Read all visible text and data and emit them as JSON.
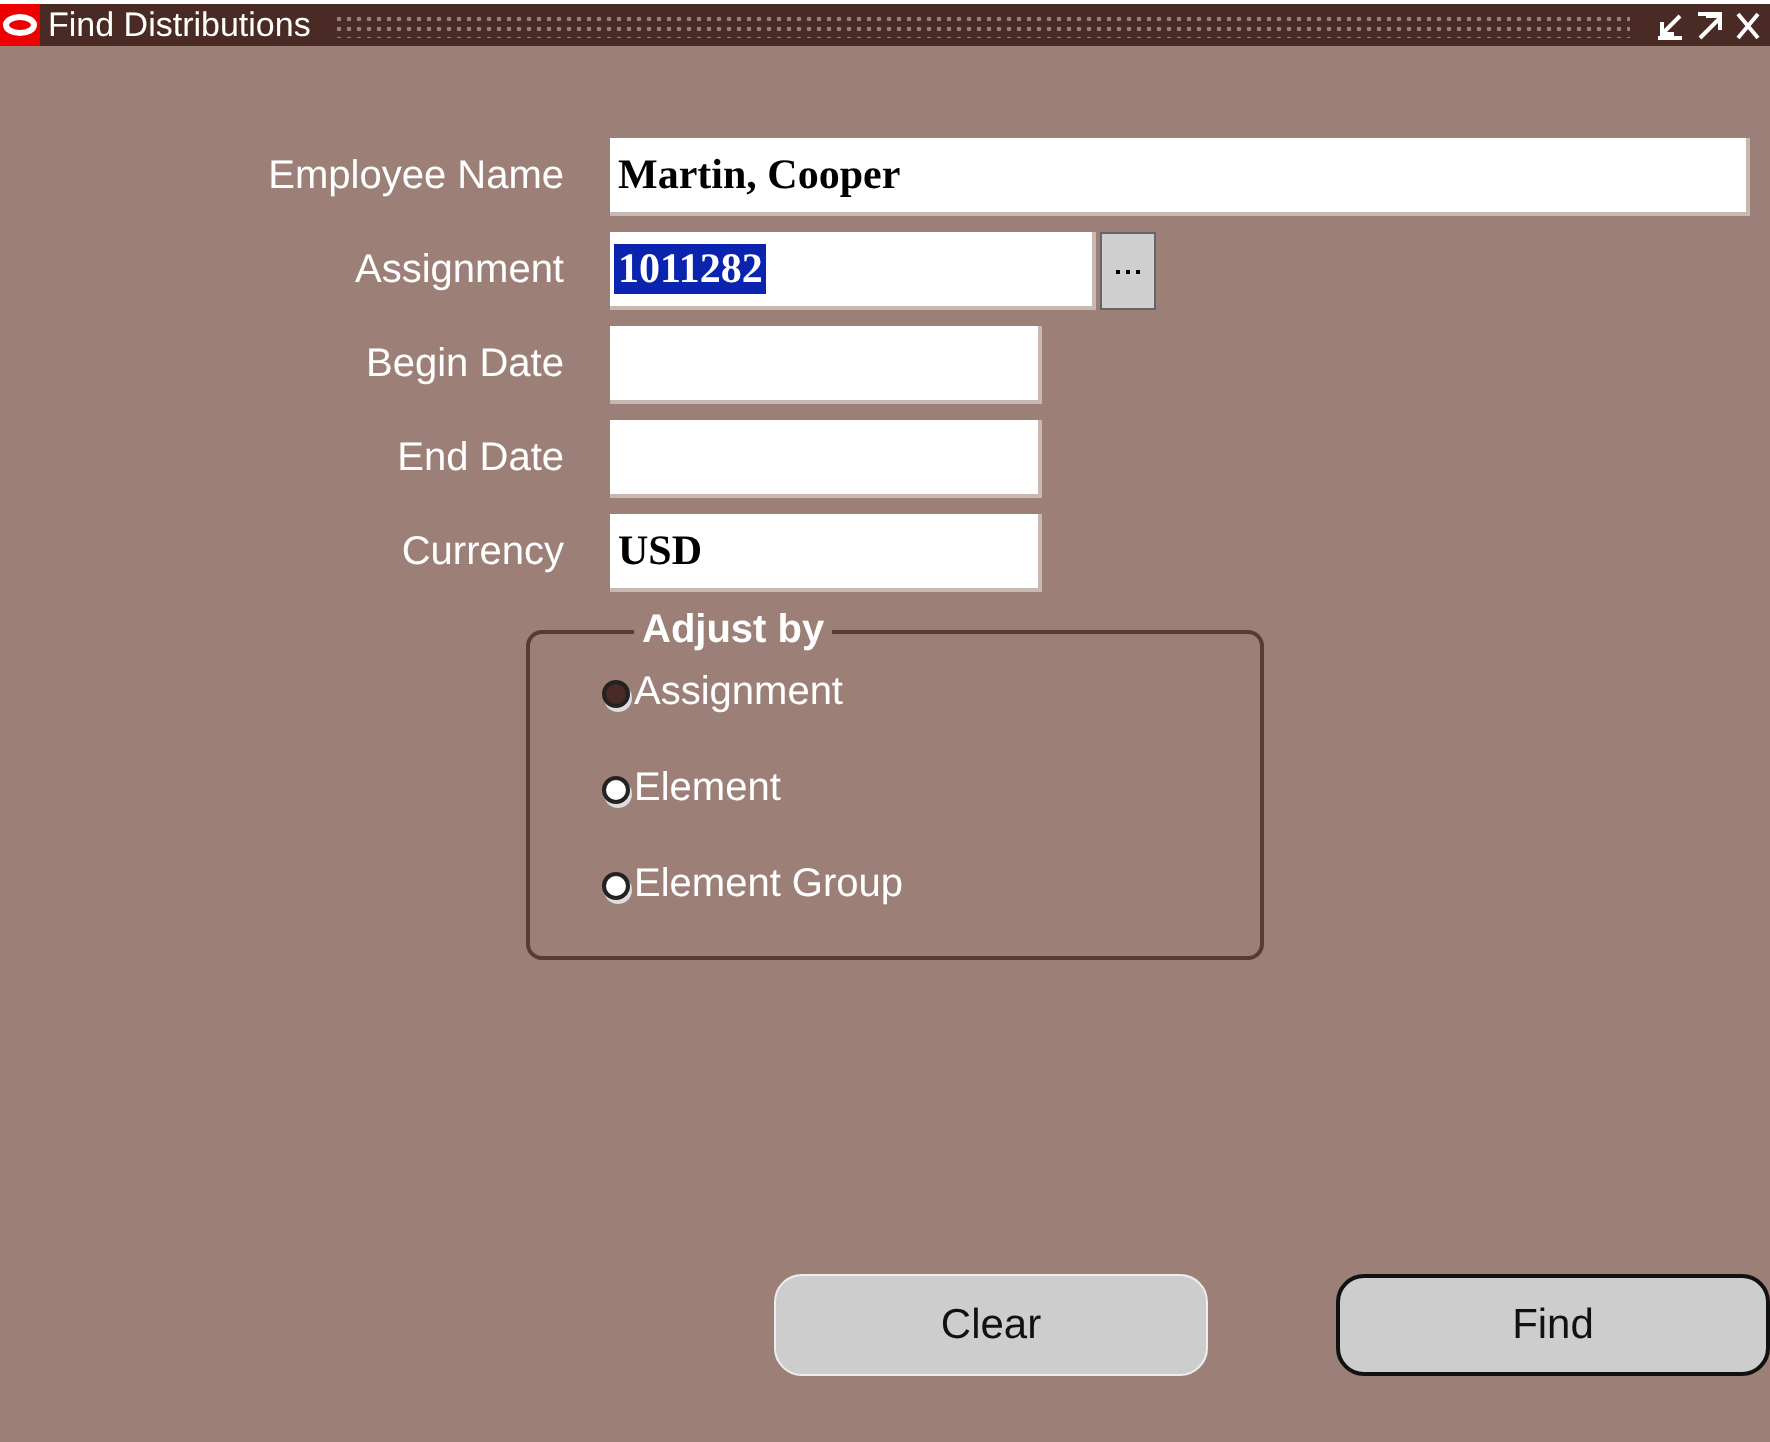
{
  "window": {
    "title": "Find Distributions"
  },
  "fields": [
    {
      "label": "Employee Name",
      "value": "Martin, Cooper",
      "kind": "wide",
      "selected": false
    },
    {
      "label": "Assignment",
      "value": "1011282",
      "kind": "lov",
      "selected": true
    },
    {
      "label": "Begin Date",
      "kind": "short"
    },
    {
      "label": "End Date",
      "kind": "short"
    },
    {
      "label": "Currency",
      "value": "USD",
      "kind": "short",
      "selected": false
    }
  ],
  "adjust_by": {
    "title": "Adjust by",
    "options": [
      {
        "label": "Assignment",
        "selected": true
      },
      {
        "label": "Element",
        "selected": false
      },
      {
        "label": "Element Group",
        "selected": false
      }
    ]
  },
  "buttons": [
    {
      "label": "Clear",
      "default": false
    },
    {
      "label": "Find",
      "default": true
    }
  ]
}
